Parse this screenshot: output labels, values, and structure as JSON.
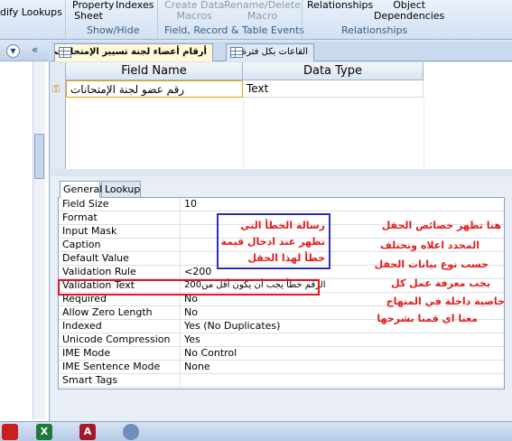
{
  "ribbon": {
    "lookups_label": "dify Lookups",
    "property_sheet": "Property\nSheet",
    "indexes": "Indexes",
    "show_hide": "Show/Hide",
    "create_data_macros": "Create Data\nMacros",
    "rename_delete_macro": "Rename/Delete\nMacro",
    "field_record_table_events": "Field, Record & Table Events",
    "relationships": "Relationships",
    "object_dependencies": "Object\nDependencies",
    "relationships_group": "Relationships"
  },
  "tabs": {
    "active": "أرقام أعضاء لجنة تسيير الإمتحانات",
    "inactive": "القاعات بكل فترة"
  },
  "grid": {
    "col_field_name": "Field Name",
    "col_data_type": "Data Type",
    "row_field_name": "رقم عضو لجنة الإمتحانات",
    "row_data_type": "Text"
  },
  "props": {
    "tab_general": "General",
    "tab_lookup": "Lookup",
    "rows": [
      {
        "name": "Field Size",
        "value": "10"
      },
      {
        "name": "Format",
        "value": ""
      },
      {
        "name": "Input Mask",
        "value": ""
      },
      {
        "name": "Caption",
        "value": ""
      },
      {
        "name": "Default Value",
        "value": ""
      },
      {
        "name": "Validation Rule",
        "value": "<200"
      },
      {
        "name": "Validation Text",
        "value": "200الرقم خطأ يجب أن يكون أقل من"
      },
      {
        "name": "Required",
        "value": "No"
      },
      {
        "name": "Allow Zero Length",
        "value": "No"
      },
      {
        "name": "Indexed",
        "value": "Yes (No Duplicates)"
      },
      {
        "name": "Unicode Compression",
        "value": "Yes"
      },
      {
        "name": "IME Mode",
        "value": "No Control"
      },
      {
        "name": "IME Sentence Mode",
        "value": "None"
      },
      {
        "name": "Smart Tags",
        "value": ""
      }
    ]
  },
  "callouts": {
    "blue_box": [
      "رسالة الخطأ التي",
      "تظهر عند ادخال قيمة",
      "خطأ لهذا الحقل"
    ],
    "side_note": [
      "هنا تظهر خصائص الحقل",
      "المحدد اعلاه وتختلف",
      "حسب نوع بيانات الحقل",
      "يجب معرفة عمل كل",
      "خاصية داخلة في المنهاج",
      "معنا اي قمنا بشرحها"
    ]
  },
  "nav": {
    "collapse_glyph": "«",
    "menu_glyph": "▼"
  },
  "taskbar": {
    "icons": [
      "pdf-icon",
      "excel-icon",
      "access-icon",
      "app-icon"
    ],
    "labels": [
      "",
      "X",
      "A",
      ""
    ]
  },
  "colors": {
    "highlight": "#e3161c",
    "callout_border": "#2d2db8",
    "note_text": "#e31c1c"
  }
}
